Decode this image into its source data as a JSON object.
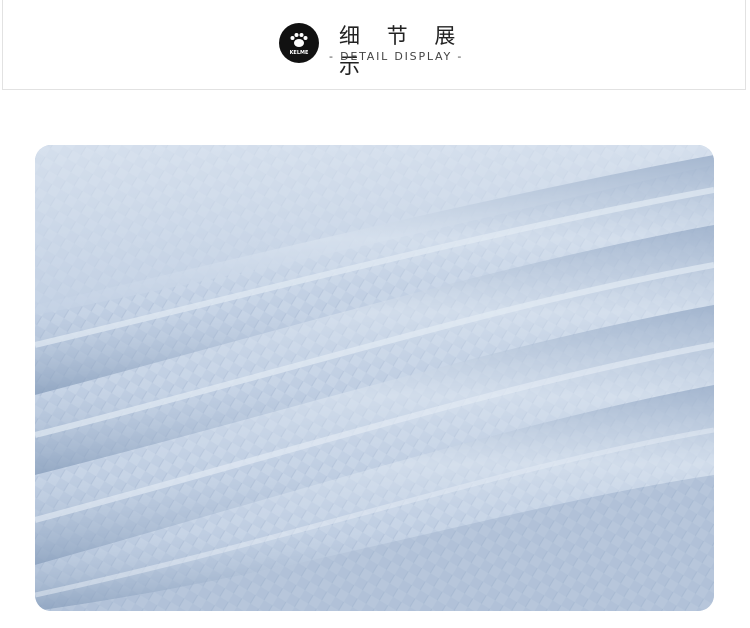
{
  "header": {
    "logo_text": "KELME",
    "title_zh": "细 节 展 示",
    "title_en": "- DETAIL DISPLAY -"
  },
  "image": {
    "subject": "fabric-detail",
    "colors": {
      "fabric_base": "#b9c9de",
      "fabric_light": "#d8e2ee",
      "fabric_shadow": "#8fa4c0"
    }
  }
}
